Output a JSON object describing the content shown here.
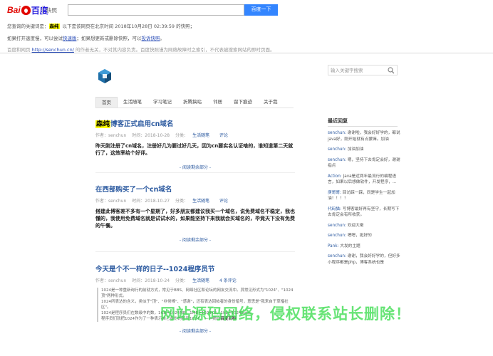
{
  "baidu": {
    "logo_left": "Bai",
    "logo_right": "百度",
    "section": "快照",
    "search_value": "",
    "search_button": "百度一下",
    "line1_prefix": "您查询的关键词是：",
    "line1_keyword": "森纯",
    "line1_suffix": "以下是该网页在北京时间 2018年10月28日 02:39:59 的快照；",
    "line2_prefix": "如果打开速度慢，可以尝试",
    "line2_link1": "快速版",
    "line2_mid": "；如果想更新或删除快照，可以",
    "line2_link2": "投诉快照",
    "line2_end": "。",
    "line3_prefix": "百度和网页 ",
    "line3_url": "http://senchun.cn/",
    "line3_suffix": " 的作者无关，不对其内容负责。百度快照谨为网络故障时之索引，不代表被搜索网站的即时页面。"
  },
  "blog": {
    "search_placeholder": "输入关键字搜索",
    "nav": [
      "首页",
      "生活随笔",
      "学习笔记",
      "折腾搞站",
      "邻居",
      "留下痕迹",
      "关于我"
    ],
    "posts": [
      {
        "title_hl": "森纯",
        "title_rest": "博客正式启用cn域名",
        "author": "作者：senchun",
        "time": "时间：2018-10-28",
        "cat_label": "分类：",
        "cat": "生活随笔",
        "comment": "评论",
        "body": "昨天刚注册了cn域名，注册好几为要过好几天，因为cn要实名认证啥的，谁知道第二天就行了，这效率给个好评。",
        "more": "- 阅读剩余部分 -"
      },
      {
        "title_hl": "",
        "title_rest": "在西部购买了一个cn域名",
        "author": "作者：senchun",
        "time": "时间：2018-10-27",
        "cat_label": "分类：",
        "cat": "生活随笔",
        "comment": "评论",
        "body": "搭建此博客差不多有一个星期了，好多朋友都建议我买一个域名，说免费域名不稳定，我也懂的，我使用免费域名就是试试水的，如果能坚持下来我就会买域名的，毕竟天下没有免费的午餐。",
        "more": "- 阅读剩余部分 -"
      },
      {
        "title_hl": "",
        "title_rest": "今天是个不一样的日子--1024程序员节",
        "author": "作者：senchun",
        "time": "时间：2018-10-24",
        "cat_label": "分类：",
        "cat": "生活随笔",
        "comment": "4 条评论",
        "q1": "1024是一种重新询行的前就方式，常见于BBS、网络社区和论坛的网友交流中。其常见形式为\"1024\"、\"1024顶\"两种形式。",
        "q2": "1024所表达的含义，类似于\"顶\"、\"非常棒\"、\"感谢\"，还有表达回帖者的身份暗号，意思是\"我来自于草榴社区\"。",
        "q3": "1024是程序员们在数级中的数，1GB=1024MB，1MB=1024KB，1kb=1024Byte。",
        "q4": "程序员们就把1024作为了一种表示自己身份的符号1024。 ——摘自",
        "q4_bold": "百度百科",
        "more": "- 阅读剩余部分 -"
      }
    ],
    "sidebar_title": "最近回复",
    "sidebar": [
      {
        "who": "senchun:",
        "text": " 谢谢啦，我会好好学的，都说java好，刚开始就有点蒙嘛。加油"
      },
      {
        "who": "senchun:",
        "text": " 加油加油"
      },
      {
        "who": "senchun:",
        "text": " 嗯，坚持下去肯定会好，谢谢指点"
      },
      {
        "who": "Action:",
        "text": " Java是近两年最流行的编程语言，如果以后想做软件，开发程序，..."
      },
      {
        "who": "庚哥哥:",
        "text": " 回访踩一踩，同是学生一起加油！！！！"
      },
      {
        "who": "代码猫:",
        "text": " 写博客最好再有坚守，长期写下去肯定会有所收获。"
      },
      {
        "who": "senchun:",
        "text": " 欢迎大佬"
      },
      {
        "who": "senchun:",
        "text": " 嗯嗯，挺好的"
      },
      {
        "who": "Pank:",
        "text": " 大发的主题"
      },
      {
        "who": "senchun:",
        "text": " 谢谢，我会好好学的，但好多小程序都是php，博客系统也是"
      }
    ],
    "watermark": "网站源码网络，侵权联系站长删除！"
  },
  "colors": {
    "baidu_red": "#e10601",
    "baidu_blue": "#3385ff",
    "link_blue": "#2c5aa0",
    "highlight": "#ffff00",
    "watermark": "#3cdc50"
  }
}
